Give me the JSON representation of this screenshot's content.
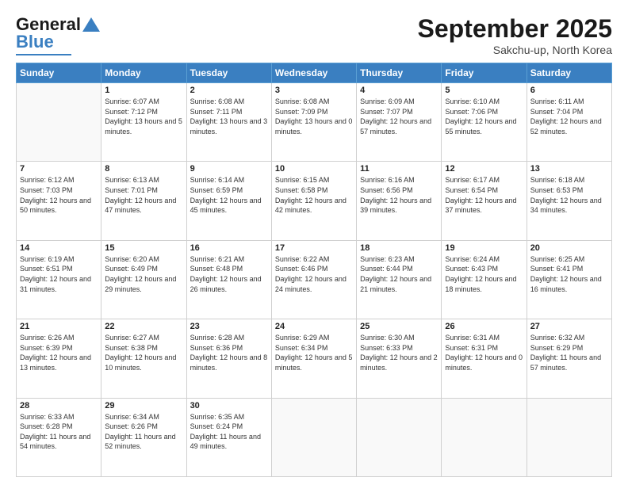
{
  "header": {
    "logo_general": "General",
    "logo_blue": "Blue",
    "month_title": "September 2025",
    "location": "Sakchu-up, North Korea"
  },
  "weekdays": [
    "Sunday",
    "Monday",
    "Tuesday",
    "Wednesday",
    "Thursday",
    "Friday",
    "Saturday"
  ],
  "weeks": [
    [
      {
        "day": "",
        "sunrise": "",
        "sunset": "",
        "daylight": ""
      },
      {
        "day": "1",
        "sunrise": "Sunrise: 6:07 AM",
        "sunset": "Sunset: 7:12 PM",
        "daylight": "Daylight: 13 hours and 5 minutes."
      },
      {
        "day": "2",
        "sunrise": "Sunrise: 6:08 AM",
        "sunset": "Sunset: 7:11 PM",
        "daylight": "Daylight: 13 hours and 3 minutes."
      },
      {
        "day": "3",
        "sunrise": "Sunrise: 6:08 AM",
        "sunset": "Sunset: 7:09 PM",
        "daylight": "Daylight: 13 hours and 0 minutes."
      },
      {
        "day": "4",
        "sunrise": "Sunrise: 6:09 AM",
        "sunset": "Sunset: 7:07 PM",
        "daylight": "Daylight: 12 hours and 57 minutes."
      },
      {
        "day": "5",
        "sunrise": "Sunrise: 6:10 AM",
        "sunset": "Sunset: 7:06 PM",
        "daylight": "Daylight: 12 hours and 55 minutes."
      },
      {
        "day": "6",
        "sunrise": "Sunrise: 6:11 AM",
        "sunset": "Sunset: 7:04 PM",
        "daylight": "Daylight: 12 hours and 52 minutes."
      }
    ],
    [
      {
        "day": "7",
        "sunrise": "Sunrise: 6:12 AM",
        "sunset": "Sunset: 7:03 PM",
        "daylight": "Daylight: 12 hours and 50 minutes."
      },
      {
        "day": "8",
        "sunrise": "Sunrise: 6:13 AM",
        "sunset": "Sunset: 7:01 PM",
        "daylight": "Daylight: 12 hours and 47 minutes."
      },
      {
        "day": "9",
        "sunrise": "Sunrise: 6:14 AM",
        "sunset": "Sunset: 6:59 PM",
        "daylight": "Daylight: 12 hours and 45 minutes."
      },
      {
        "day": "10",
        "sunrise": "Sunrise: 6:15 AM",
        "sunset": "Sunset: 6:58 PM",
        "daylight": "Daylight: 12 hours and 42 minutes."
      },
      {
        "day": "11",
        "sunrise": "Sunrise: 6:16 AM",
        "sunset": "Sunset: 6:56 PM",
        "daylight": "Daylight: 12 hours and 39 minutes."
      },
      {
        "day": "12",
        "sunrise": "Sunrise: 6:17 AM",
        "sunset": "Sunset: 6:54 PM",
        "daylight": "Daylight: 12 hours and 37 minutes."
      },
      {
        "day": "13",
        "sunrise": "Sunrise: 6:18 AM",
        "sunset": "Sunset: 6:53 PM",
        "daylight": "Daylight: 12 hours and 34 minutes."
      }
    ],
    [
      {
        "day": "14",
        "sunrise": "Sunrise: 6:19 AM",
        "sunset": "Sunset: 6:51 PM",
        "daylight": "Daylight: 12 hours and 31 minutes."
      },
      {
        "day": "15",
        "sunrise": "Sunrise: 6:20 AM",
        "sunset": "Sunset: 6:49 PM",
        "daylight": "Daylight: 12 hours and 29 minutes."
      },
      {
        "day": "16",
        "sunrise": "Sunrise: 6:21 AM",
        "sunset": "Sunset: 6:48 PM",
        "daylight": "Daylight: 12 hours and 26 minutes."
      },
      {
        "day": "17",
        "sunrise": "Sunrise: 6:22 AM",
        "sunset": "Sunset: 6:46 PM",
        "daylight": "Daylight: 12 hours and 24 minutes."
      },
      {
        "day": "18",
        "sunrise": "Sunrise: 6:23 AM",
        "sunset": "Sunset: 6:44 PM",
        "daylight": "Daylight: 12 hours and 21 minutes."
      },
      {
        "day": "19",
        "sunrise": "Sunrise: 6:24 AM",
        "sunset": "Sunset: 6:43 PM",
        "daylight": "Daylight: 12 hours and 18 minutes."
      },
      {
        "day": "20",
        "sunrise": "Sunrise: 6:25 AM",
        "sunset": "Sunset: 6:41 PM",
        "daylight": "Daylight: 12 hours and 16 minutes."
      }
    ],
    [
      {
        "day": "21",
        "sunrise": "Sunrise: 6:26 AM",
        "sunset": "Sunset: 6:39 PM",
        "daylight": "Daylight: 12 hours and 13 minutes."
      },
      {
        "day": "22",
        "sunrise": "Sunrise: 6:27 AM",
        "sunset": "Sunset: 6:38 PM",
        "daylight": "Daylight: 12 hours and 10 minutes."
      },
      {
        "day": "23",
        "sunrise": "Sunrise: 6:28 AM",
        "sunset": "Sunset: 6:36 PM",
        "daylight": "Daylight: 12 hours and 8 minutes."
      },
      {
        "day": "24",
        "sunrise": "Sunrise: 6:29 AM",
        "sunset": "Sunset: 6:34 PM",
        "daylight": "Daylight: 12 hours and 5 minutes."
      },
      {
        "day": "25",
        "sunrise": "Sunrise: 6:30 AM",
        "sunset": "Sunset: 6:33 PM",
        "daylight": "Daylight: 12 hours and 2 minutes."
      },
      {
        "day": "26",
        "sunrise": "Sunrise: 6:31 AM",
        "sunset": "Sunset: 6:31 PM",
        "daylight": "Daylight: 12 hours and 0 minutes."
      },
      {
        "day": "27",
        "sunrise": "Sunrise: 6:32 AM",
        "sunset": "Sunset: 6:29 PM",
        "daylight": "Daylight: 11 hours and 57 minutes."
      }
    ],
    [
      {
        "day": "28",
        "sunrise": "Sunrise: 6:33 AM",
        "sunset": "Sunset: 6:28 PM",
        "daylight": "Daylight: 11 hours and 54 minutes."
      },
      {
        "day": "29",
        "sunrise": "Sunrise: 6:34 AM",
        "sunset": "Sunset: 6:26 PM",
        "daylight": "Daylight: 11 hours and 52 minutes."
      },
      {
        "day": "30",
        "sunrise": "Sunrise: 6:35 AM",
        "sunset": "Sunset: 6:24 PM",
        "daylight": "Daylight: 11 hours and 49 minutes."
      },
      {
        "day": "",
        "sunrise": "",
        "sunset": "",
        "daylight": ""
      },
      {
        "day": "",
        "sunrise": "",
        "sunset": "",
        "daylight": ""
      },
      {
        "day": "",
        "sunrise": "",
        "sunset": "",
        "daylight": ""
      },
      {
        "day": "",
        "sunrise": "",
        "sunset": "",
        "daylight": ""
      }
    ]
  ]
}
